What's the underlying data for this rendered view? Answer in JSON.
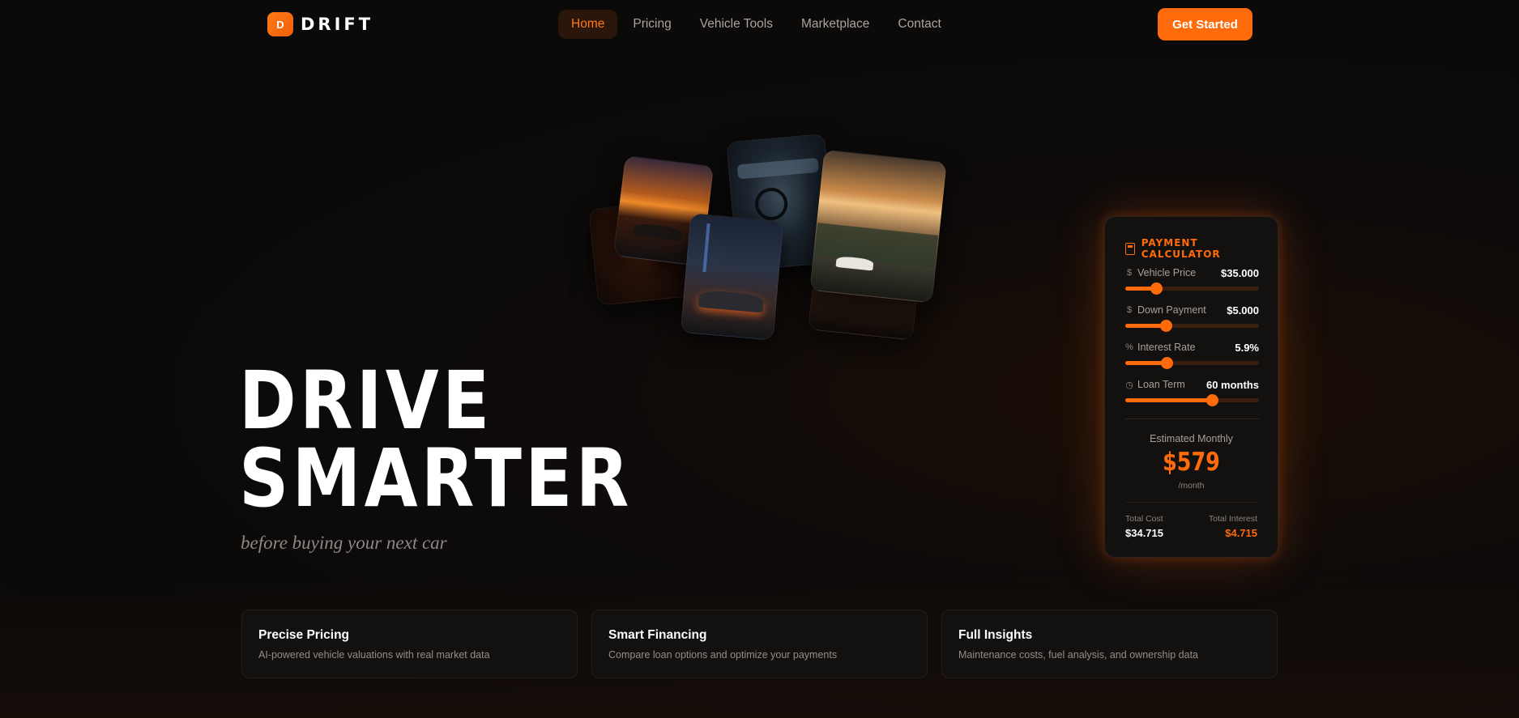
{
  "brand": {
    "logo_letter": "D",
    "name": "DRIFT",
    "accent": "#ff6b0a"
  },
  "nav": {
    "items": [
      {
        "label": "Home",
        "active": true
      },
      {
        "label": "Pricing",
        "active": false
      },
      {
        "label": "Vehicle Tools",
        "active": false
      },
      {
        "label": "Marketplace",
        "active": false
      },
      {
        "label": "Contact",
        "active": false
      }
    ],
    "cta_label": "Get Started"
  },
  "hero": {
    "title_line1": "DRIVE",
    "title_line2": "SMARTER",
    "subtitle": "before buying your next car"
  },
  "calculator": {
    "title": "PAYMENT CALCULATOR",
    "icon": "calculator-icon",
    "fields": [
      {
        "icon": "dollar-icon",
        "icon_glyph": "$",
        "label": "Vehicle Price",
        "value": "$35.000",
        "level": 0.23
      },
      {
        "icon": "dollar-icon",
        "icon_glyph": "$",
        "label": "Down Payment",
        "value": "$5.000",
        "level": 0.3
      },
      {
        "icon": "percent-icon",
        "icon_glyph": "%",
        "label": "Interest Rate",
        "value": "5.9%",
        "level": 0.31
      },
      {
        "icon": "clock-icon",
        "icon_glyph": "◷",
        "label": "Loan Term",
        "value": "60 months",
        "level": 0.65
      }
    ],
    "estimate_label": "Estimated Monthly",
    "estimate_value": "$579",
    "estimate_unit": "/month",
    "total_cost_label": "Total Cost",
    "total_cost_value": "$34.715",
    "total_interest_label": "Total Interest",
    "total_interest_value": "$4.715"
  },
  "features": [
    {
      "title": "Precise Pricing",
      "desc": "AI-powered vehicle valuations with real market data"
    },
    {
      "title": "Smart Financing",
      "desc": "Compare loan options and optimize your payments"
    },
    {
      "title": "Full Insights",
      "desc": "Maintenance costs, fuel analysis, and ownership data"
    }
  ]
}
